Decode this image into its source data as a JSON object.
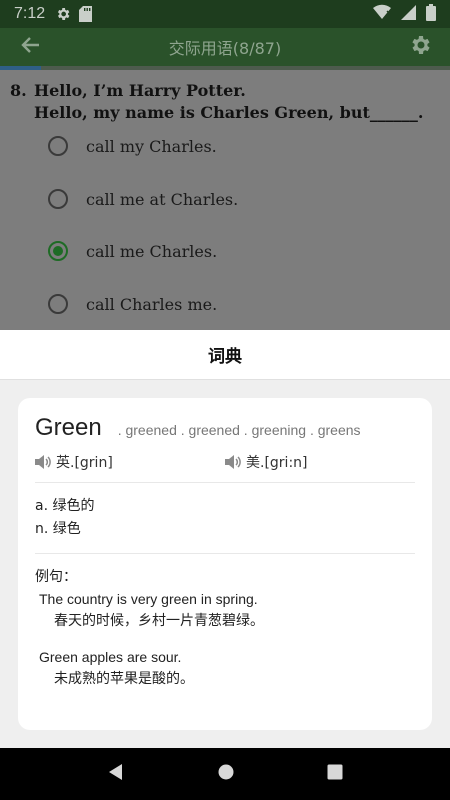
{
  "status_bar": {
    "time": "7:12"
  },
  "app_bar": {
    "title": "交际用语(8/87)"
  },
  "progress": {
    "fraction": 0.092
  },
  "question": {
    "number": "8.",
    "line1": "Hello, I’m Harry Potter.",
    "line2": "Hello, my name is Charles Green, but______.",
    "options": [
      {
        "label": "call my Charles.",
        "selected": false
      },
      {
        "label": "call me at Charles.",
        "selected": false
      },
      {
        "label": "call me Charles.",
        "selected": true
      },
      {
        "label": "call Charles me.",
        "selected": false
      }
    ]
  },
  "dictionary": {
    "header": "词典",
    "word": "Green",
    "forms": ". greened . greened . greening . greens",
    "phonetic_uk": "英.[grin]",
    "phonetic_us": "美.[gri:n]",
    "definitions": [
      "a. 绿色的",
      "n. 绿色"
    ],
    "examples_label": "例句：",
    "examples": [
      {
        "en": "The country is very green in spring.",
        "zh": "春天的时候，乡村一片青葱碧绿。"
      },
      {
        "en": "Green apples are sour.",
        "zh": "未成熟的苹果是酸的。"
      }
    ]
  },
  "colors": {
    "app_bar": "#2a522a",
    "status_bar": "#1e3d1e",
    "radio_selected": "#1e6b25"
  },
  "icons": [
    "settings-icon",
    "sd-card-icon",
    "wifi-icon",
    "signal-icon",
    "battery-icon",
    "back-arrow-icon",
    "gear-icon",
    "speaker-icon",
    "nav-back-icon",
    "nav-home-icon",
    "nav-recents-icon"
  ]
}
